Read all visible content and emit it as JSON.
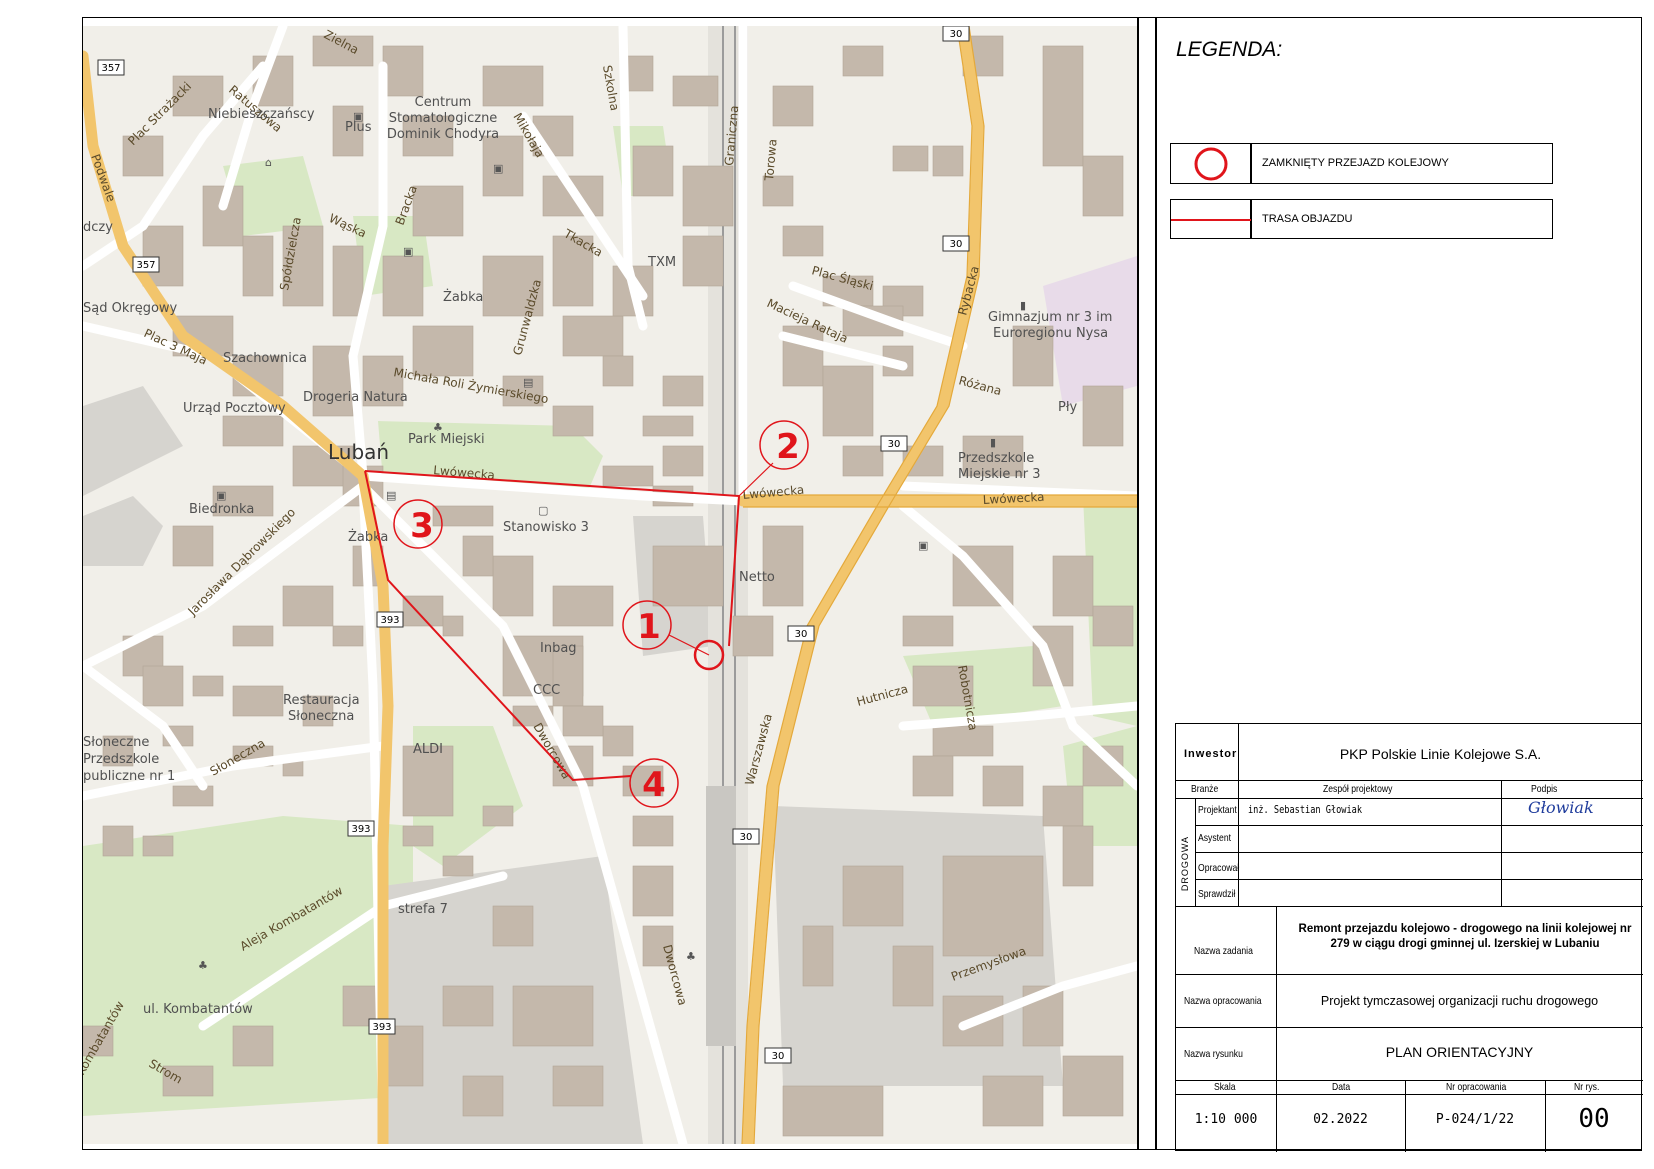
{
  "legend": {
    "title": "LEGENDA:",
    "items": [
      {
        "label": "ZAMKNIĘTY PRZEJAZD KOLEJOWY",
        "symbol": "red-circle"
      },
      {
        "label": "TRASA OBJAZDU",
        "symbol": "red-line"
      }
    ]
  },
  "map": {
    "city": "Lubań",
    "markers": [
      "1",
      "2",
      "3",
      "4"
    ],
    "closed_crossing_color": "#e0151b",
    "route_color": "#e0151b",
    "street_labels": [
      "Zielna",
      "Ratuszowa",
      "Plac Strażacki",
      "Podwale",
      "Niebieszczańscy",
      "Centrum Stomatologiczne Dominik Chodyra",
      "Plus",
      "Mikołaja",
      "Szkolna",
      "Graniczna",
      "Torowa",
      "Wąska",
      "Bracka",
      "Tkacka",
      "TXM",
      "Spółdzielcza",
      "Żabka",
      "Grunwaldzka",
      "Plac Śląski",
      "Macieja Rataja",
      "Szachownica",
      "Drogeria Natura",
      "Michała Roli Żymierskiego",
      "Park Miejski",
      "Sąd Okręgowy",
      "Plac 3 Maja",
      "Urząd Pocztowy",
      "Lwówecka",
      "Biedronka",
      "Stanowisko 3",
      "Jarosława Dąbrowskiego",
      "Netto",
      "Inbag",
      "CCC",
      "ALDI",
      "Restauracja Słoneczna",
      "Słoneczna",
      "Słoneczne Przedszkole Publiczne nr 1",
      "Dworcowa",
      "Warszawska",
      "Hutnicza",
      "Robotnicza",
      "Przemysłowa",
      "Aleja Kombatantów",
      "ul. Kombatantów",
      "Strefa 7",
      "Gimnazjum nr 3 im. Euroregionu Nysa",
      "Różana",
      "Rybacka",
      "Przedszkole Miejskie nr 3",
      "Dcz",
      "Kombatantów",
      "Strom"
    ],
    "road_shields": [
      "357",
      "357",
      "30",
      "30",
      "30",
      "30",
      "30",
      "30",
      "393",
      "393",
      "393"
    ]
  },
  "title_block": {
    "investor_label": "Inwestor",
    "investor_value": "PKP Polskie Linie Kolejowe S.A.",
    "branza_label": "Branże",
    "team_label": "Zespół projektowy",
    "signature_label": "Podpis",
    "discipline": "DROGOWA",
    "roles": [
      {
        "role": "Projektant",
        "name": "inż. Sebastian Głowiak",
        "signature": "Głowiak"
      },
      {
        "role": "Asystent",
        "name": "",
        "signature": ""
      },
      {
        "role": "Opracował",
        "name": "",
        "signature": ""
      },
      {
        "role": "Sprawdził",
        "name": "",
        "signature": ""
      }
    ],
    "task_label": "Nazwa zadania",
    "task_value": "Remont przejazdu kolejowo - drogowego na linii kolejowej nr 279 w ciągu drogi gminnej ul. Izerskiej w Lubaniu",
    "study_label": "Nazwa opracowania",
    "study_value": "Projekt tymczasowej organizacji ruchu drogowego",
    "drawing_label": "Nazwa rysunku",
    "drawing_value": "PLAN ORIENTACYJNY",
    "scale_label": "Skala",
    "scale_value": "1:10 000",
    "date_label": "Data",
    "date_value": "02.2022",
    "nr_opr_label": "Nr opracowania",
    "nr_opr_value": "P-024/1/22",
    "nr_rys_label": "Nr rys.",
    "nr_rys_value": "00"
  }
}
